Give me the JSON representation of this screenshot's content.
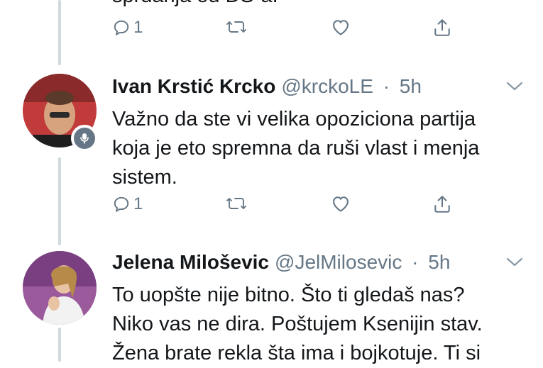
{
  "tweets": [
    {
      "partial_text": "sprdanja od DS-a.",
      "reply_count": "1"
    },
    {
      "name": "Ivan Krstić Krcko",
      "handle": "@krckoLE",
      "separator": "·",
      "time": "5h",
      "text": "Važno da ste vi velika opoziciona partija\nkoja je eto spremna da ruši vlast i menja\nsistem.",
      "reply_count": "1"
    },
    {
      "name": "Jelena Miloševic",
      "handle": "@JelMilosevic",
      "separator": "·",
      "time": "5h",
      "text": "To uopšte nije bitno. Što ti gledaš nas?\nNiko vas ne dira. Poštujem Ksenijin stav.\nŽena brate rekla šta ima i bojkotuje. Ti si"
    }
  ],
  "icons": {
    "reply": "reply-icon",
    "retweet": "retweet-icon",
    "like": "heart-icon",
    "share": "share-icon",
    "more": "chevron-down-icon",
    "mic": "microphone-icon"
  },
  "colors": {
    "icon_gray": "#657786",
    "thread_line": "#cfd9de",
    "text": "#14171a"
  }
}
